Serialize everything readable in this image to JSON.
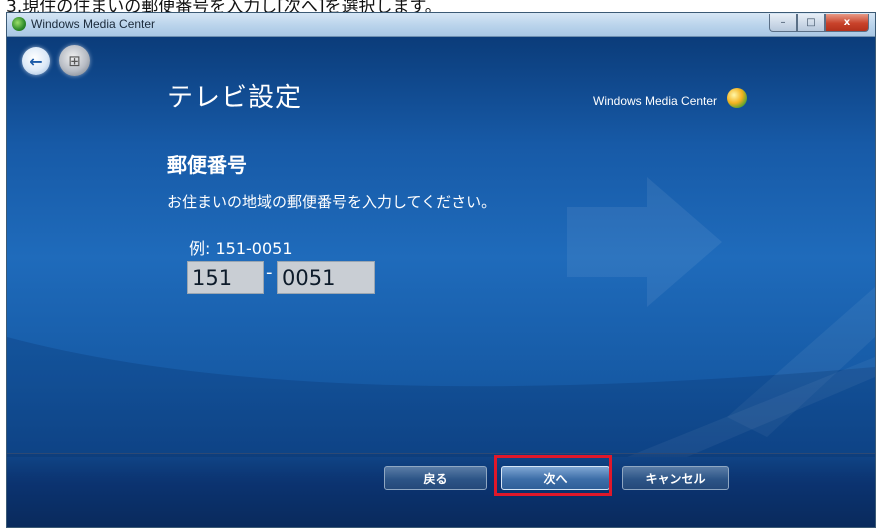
{
  "caption": "3.現住の住まいの郵便番号を入力し[次へ]を選択します。",
  "window": {
    "title": "Windows Media Center",
    "controls": {
      "minimize": "–",
      "maximize": "□",
      "close": "x"
    }
  },
  "header": {
    "back_icon": "←",
    "start_icon": "⊞",
    "page_title": "テレビ設定",
    "brand": "Windows Media Center"
  },
  "form": {
    "section_title": "郵便番号",
    "instruction": "お住まいの地域の郵便番号を入力してください。",
    "example": "例: 151-0051",
    "zip_part1": "151",
    "separator": "-",
    "zip_part2": "0051"
  },
  "footer": {
    "back_label": "戻る",
    "next_label": "次へ",
    "cancel_label": "キャンセル"
  },
  "colors": {
    "background": "#175aa7",
    "highlight": "#e0182a",
    "field": "#c9ced4"
  }
}
